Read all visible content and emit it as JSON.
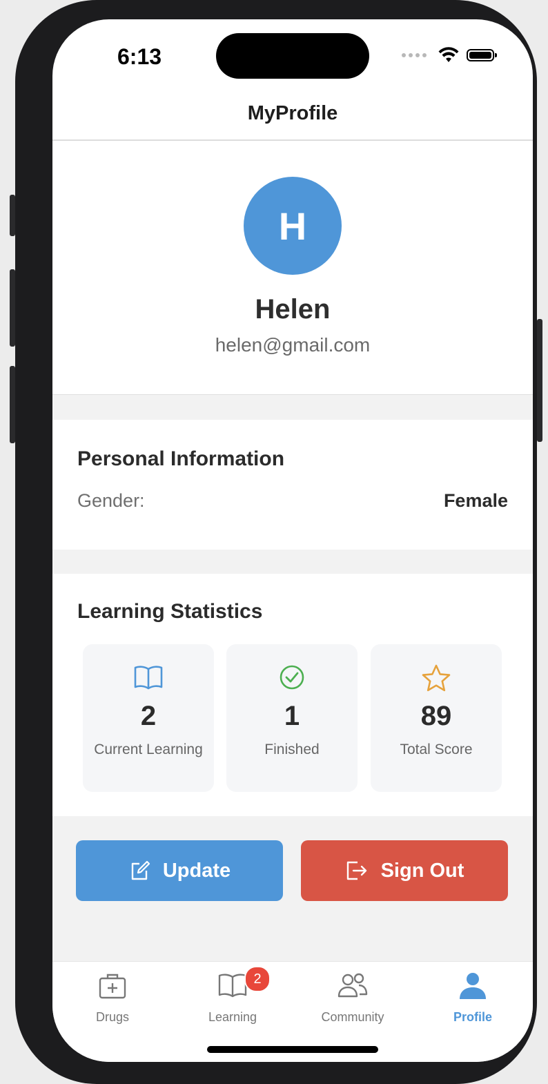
{
  "status_bar": {
    "time": "6:13"
  },
  "header": {
    "title": "MyProfile"
  },
  "profile": {
    "avatar_initial": "H",
    "name": "Helen",
    "email": "helen@gmail.com"
  },
  "personal_info": {
    "title": "Personal Information",
    "rows": [
      {
        "label": "Gender:",
        "value": "Female"
      }
    ]
  },
  "stats": {
    "title": "Learning Statistics",
    "items": [
      {
        "icon": "book-icon",
        "value": "2",
        "label": "Current Learning",
        "color": "#4f96d8"
      },
      {
        "icon": "check-circle-icon",
        "value": "1",
        "label": "Finished",
        "color": "#4caf50"
      },
      {
        "icon": "star-icon",
        "value": "89",
        "label": "Total Score",
        "color": "#e6a23c"
      }
    ]
  },
  "actions": {
    "update_label": "Update",
    "signout_label": "Sign Out"
  },
  "tabbar": {
    "tabs": [
      {
        "label": "Drugs",
        "icon": "medical-kit-icon"
      },
      {
        "label": "Learning",
        "icon": "book-icon",
        "badge": "2"
      },
      {
        "label": "Community",
        "icon": "people-icon"
      },
      {
        "label": "Profile",
        "icon": "person-icon",
        "active": true
      }
    ]
  },
  "colors": {
    "accent": "#4f96d8",
    "danger": "#d85545",
    "badge": "#e8473a"
  }
}
